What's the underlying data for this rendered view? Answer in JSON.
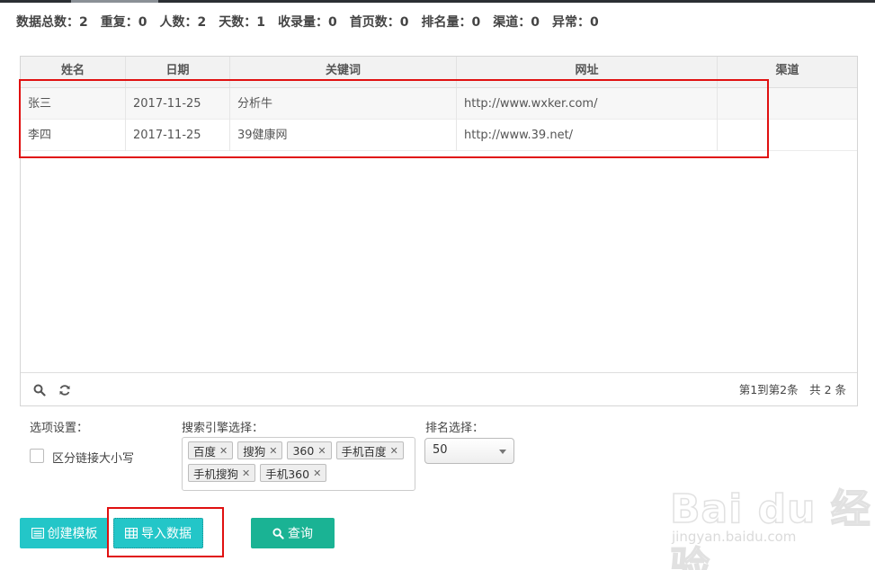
{
  "stats": [
    {
      "label": "数据总数：",
      "value": "2"
    },
    {
      "label": "重复：",
      "value": "0"
    },
    {
      "label": "人数：",
      "value": "2"
    },
    {
      "label": "天数：",
      "value": "1"
    },
    {
      "label": "收录量：",
      "value": "0"
    },
    {
      "label": "首页数：",
      "value": "0"
    },
    {
      "label": "排名量：",
      "value": "0"
    },
    {
      "label": "渠道：",
      "value": "0"
    },
    {
      "label": "异常：",
      "value": "0"
    }
  ],
  "table": {
    "columns": [
      "姓名",
      "日期",
      "关键词",
      "网址",
      "渠道"
    ],
    "rows": [
      [
        "张三",
        "2017-11-25",
        "分析牛",
        "http://www.wxker.com/",
        ""
      ],
      [
        "李四",
        "2017-11-25",
        "39健康网",
        "http://www.39.net/",
        ""
      ]
    ],
    "pager": "第1到第2条　共 2 条"
  },
  "options": {
    "title": "选项设置：",
    "case_label": "区分链接大小写"
  },
  "engines": {
    "title": "搜索引擎选择：",
    "tags": [
      "百度",
      "搜狗",
      "360",
      "手机百度",
      "手机搜狗",
      "手机360"
    ]
  },
  "rank": {
    "title": "排名选择：",
    "selected": "50"
  },
  "buttons": {
    "create": "创建模板",
    "import": "导入数据",
    "query": "查询"
  },
  "watermark": {
    "main": "Bai du 经验",
    "sub": "jingyan.baidu.com"
  },
  "colors": {
    "teal": "#23c6c8",
    "green": "#1ab394",
    "highlight": "#e01010"
  }
}
